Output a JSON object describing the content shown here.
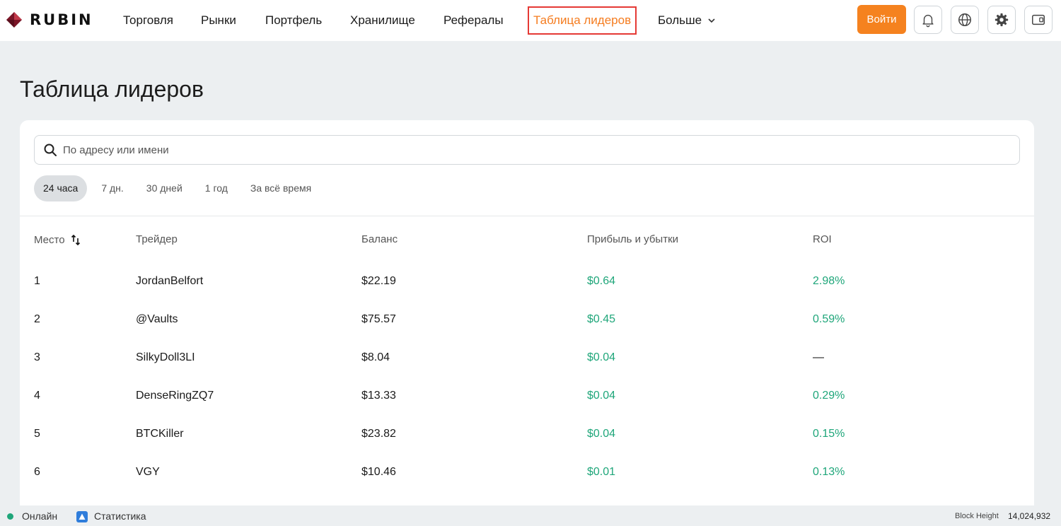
{
  "brand": {
    "name": "RUBIN",
    "color": "#8b1a2b"
  },
  "nav": {
    "items": [
      {
        "label": "Торговля"
      },
      {
        "label": "Рынки"
      },
      {
        "label": "Портфель"
      },
      {
        "label": "Хранилище"
      },
      {
        "label": "Рефералы"
      },
      {
        "label": "Таблица лидеров",
        "active": true
      },
      {
        "label": "Больше"
      }
    ],
    "login_label": "Войти",
    "icons": [
      "bell-icon",
      "globe-icon",
      "gear-icon",
      "wallet-icon"
    ]
  },
  "page": {
    "title": "Таблица лидеров"
  },
  "search": {
    "placeholder": "По адресу или имени",
    "value": ""
  },
  "periods": [
    {
      "label": "24 часа",
      "active": true
    },
    {
      "label": "7 дн."
    },
    {
      "label": "30 дней"
    },
    {
      "label": "1 год"
    },
    {
      "label": "За всё время"
    }
  ],
  "table": {
    "headers": {
      "rank": "Место",
      "trader": "Трейдер",
      "balance": "Баланс",
      "pnl": "Прибыль и убытки",
      "roi": "ROI"
    },
    "rows": [
      {
        "rank": "1",
        "trader": "JordanBelfort",
        "balance": "$22.19",
        "pnl": "$0.64",
        "roi": "2.98%"
      },
      {
        "rank": "2",
        "trader": "@Vaults",
        "balance": "$75.57",
        "pnl": "$0.45",
        "roi": "0.59%"
      },
      {
        "rank": "3",
        "trader": "SilkyDoll3LI",
        "balance": "$8.04",
        "pnl": "$0.04",
        "roi": "—"
      },
      {
        "rank": "4",
        "trader": "DenseRingZQ7",
        "balance": "$13.33",
        "pnl": "$0.04",
        "roi": "0.29%"
      },
      {
        "rank": "5",
        "trader": "BTCKiller",
        "balance": "$23.82",
        "pnl": "$0.04",
        "roi": "0.15%"
      },
      {
        "rank": "6",
        "trader": "VGY",
        "balance": "$10.46",
        "pnl": "$0.01",
        "roi": "0.13%"
      }
    ]
  },
  "status": {
    "online_label": "Онлайн",
    "stats_label": "Статистика",
    "block_height_label": "Block Height",
    "block_height_value": "14,024,932"
  },
  "colors": {
    "accent": "#f5821f",
    "positive": "#1fa67a",
    "highlight_border": "#e53935"
  }
}
